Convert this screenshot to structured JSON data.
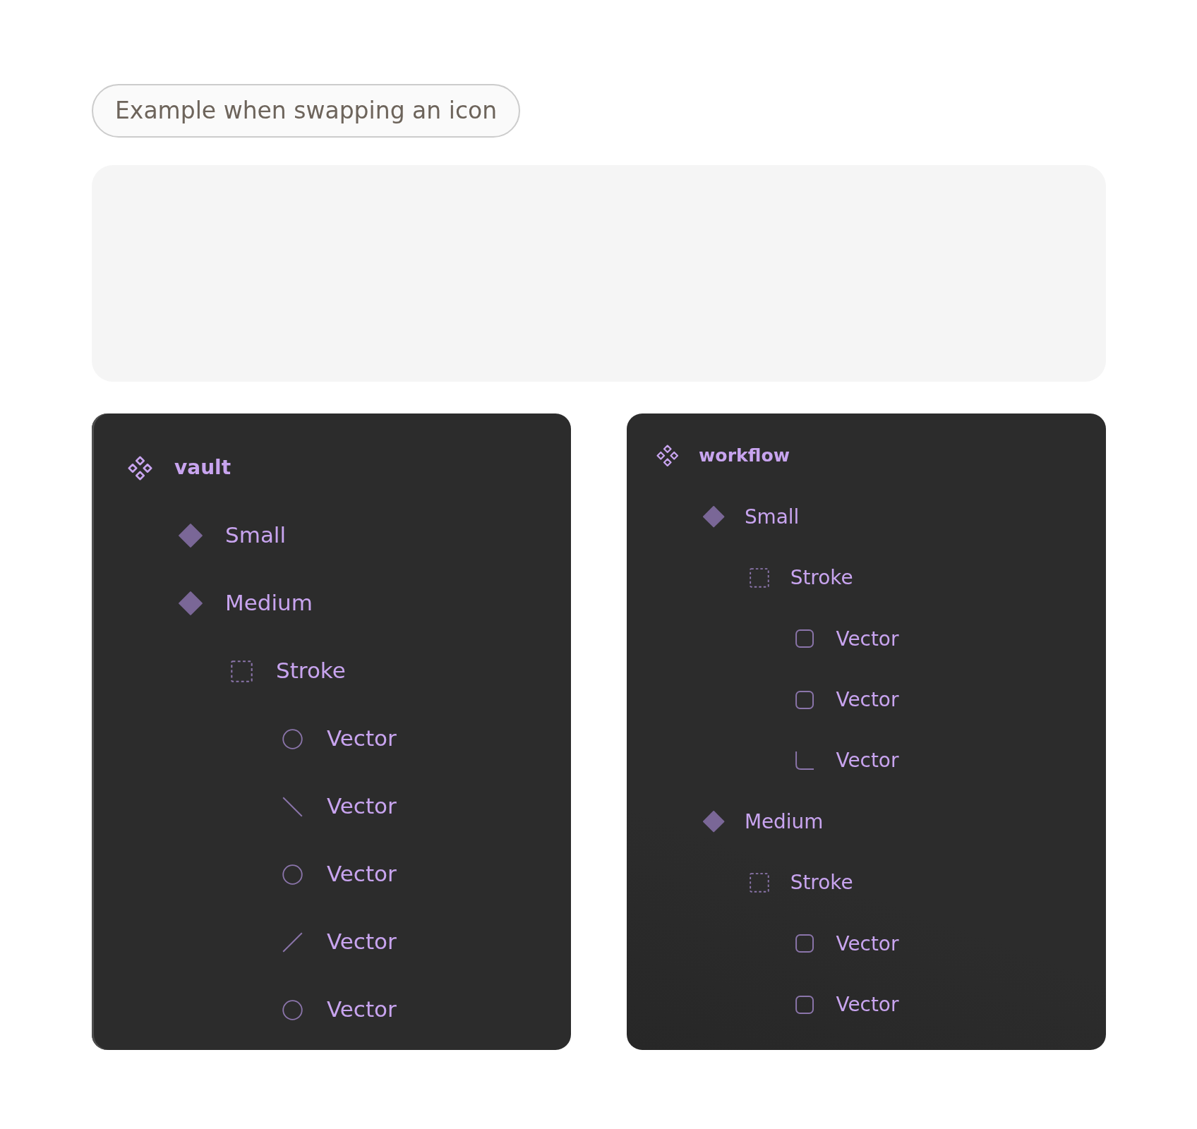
{
  "caption": {
    "text": "Example when swapping an icon"
  },
  "layer_panels": [
    {
      "kind": "component_set",
      "label": "vault",
      "children": [
        {
          "kind": "variant",
          "label": "Small"
        },
        {
          "kind": "variant",
          "label": "Medium",
          "children": [
            {
              "kind": "frame",
              "label": "Stroke",
              "children": [
                {
                  "kind": "ellipse",
                  "label": "Vector"
                },
                {
                  "kind": "slope_down",
                  "label": "Vector"
                },
                {
                  "kind": "ellipse",
                  "label": "Vector"
                },
                {
                  "kind": "slope_up",
                  "label": "Vector"
                },
                {
                  "kind": "ellipse",
                  "label": "Vector"
                }
              ]
            }
          ]
        }
      ]
    },
    {
      "kind": "component_set",
      "label": "workflow",
      "children": [
        {
          "kind": "variant",
          "label": "Small",
          "children": [
            {
              "kind": "frame",
              "label": "Stroke",
              "children": [
                {
                  "kind": "rectangle",
                  "label": "Vector"
                },
                {
                  "kind": "rectangle",
                  "label": "Vector"
                },
                {
                  "kind": "corner",
                  "label": "Vector"
                }
              ]
            }
          ]
        },
        {
          "kind": "variant",
          "label": "Medium",
          "children": [
            {
              "kind": "frame",
              "label": "Stroke",
              "children": [
                {
                  "kind": "rectangle",
                  "label": "Vector"
                },
                {
                  "kind": "rectangle",
                  "label": "Vector"
                }
              ]
            }
          ]
        }
      ]
    }
  ]
}
